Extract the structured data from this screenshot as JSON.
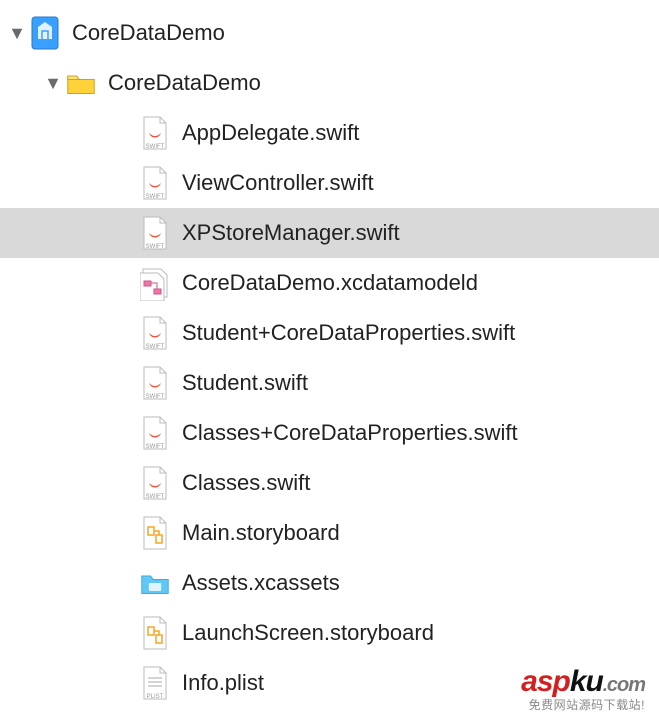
{
  "tree": {
    "root": {
      "label": "CoreDataDemo",
      "icon": "xcode-project-icon",
      "expanded": true,
      "children": [
        {
          "label": "CoreDataDemo",
          "icon": "folder-icon",
          "expanded": true,
          "children": [
            {
              "label": "AppDelegate.swift",
              "icon": "swift-file-icon"
            },
            {
              "label": "ViewController.swift",
              "icon": "swift-file-icon"
            },
            {
              "label": "XPStoreManager.swift",
              "icon": "swift-file-icon",
              "selected": true
            },
            {
              "label": "CoreDataDemo.xcdatamodeld",
              "icon": "datamodel-icon"
            },
            {
              "label": "Student+CoreDataProperties.swift",
              "icon": "swift-file-icon"
            },
            {
              "label": "Student.swift",
              "icon": "swift-file-icon"
            },
            {
              "label": "Classes+CoreDataProperties.swift",
              "icon": "swift-file-icon"
            },
            {
              "label": "Classes.swift",
              "icon": "swift-file-icon"
            },
            {
              "label": "Main.storyboard",
              "icon": "storyboard-icon"
            },
            {
              "label": "Assets.xcassets",
              "icon": "assets-icon"
            },
            {
              "label": "LaunchScreen.storyboard",
              "icon": "storyboard-icon"
            },
            {
              "label": "Info.plist",
              "icon": "plist-icon"
            }
          ]
        }
      ]
    }
  },
  "watermark": {
    "brand_red": "asp",
    "brand_black": "ku",
    "dot": ".",
    "tld": "com",
    "tagline": "免费网站源码下载站!"
  }
}
